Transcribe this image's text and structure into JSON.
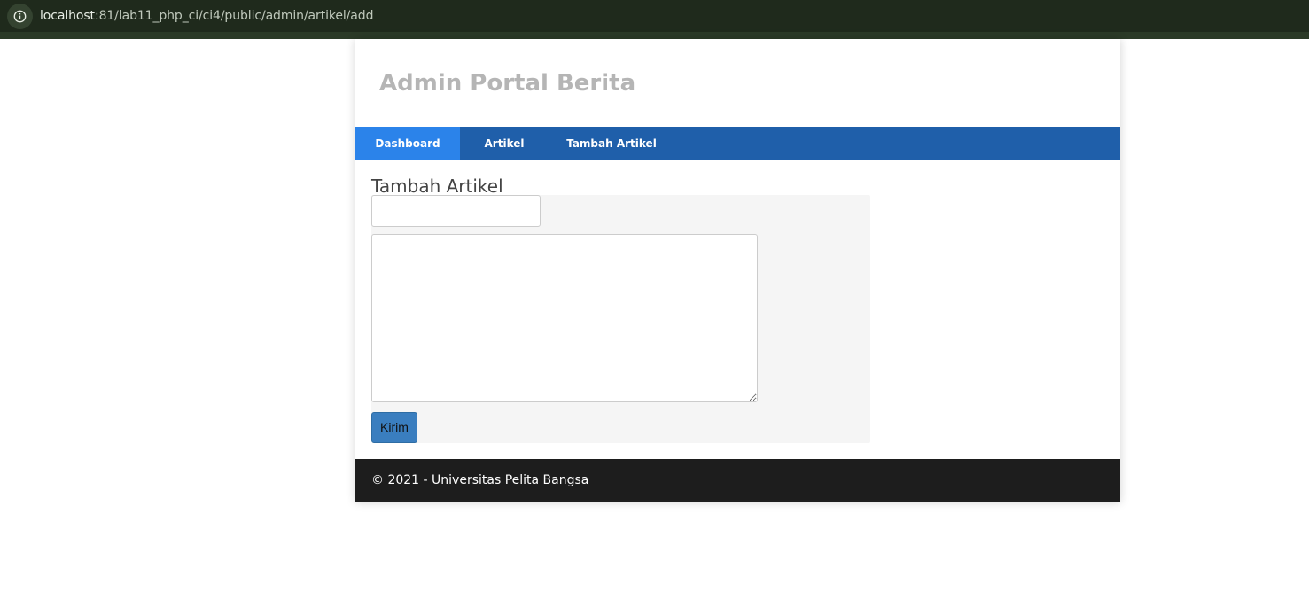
{
  "browser": {
    "url_host": "localhost",
    "url_path": ":81/lab11_php_ci/ci4/public/admin/artikel/add",
    "info_icon": "info-icon"
  },
  "header": {
    "title": "Admin Portal Berita"
  },
  "nav": {
    "items": [
      {
        "label": "Dashboard",
        "active": true
      },
      {
        "label": "Artikel",
        "active": false
      },
      {
        "label": "Tambah Artikel",
        "active": false
      }
    ]
  },
  "main": {
    "heading": "Tambah Artikel",
    "form": {
      "title_value": "",
      "content_value": "",
      "submit_label": "Kirim"
    }
  },
  "footer": {
    "text": "© 2021 - Universitas Pelita Bangsa"
  },
  "colors": {
    "browser_bar": "#1f2a1c",
    "nav_background": "#1f5faa",
    "nav_active": "#2b83ea",
    "submit_button": "#3a7ebf",
    "footer_background": "#1d1d1d",
    "title_text": "#b5b5b5",
    "form_panel": "#f5f5f5"
  }
}
